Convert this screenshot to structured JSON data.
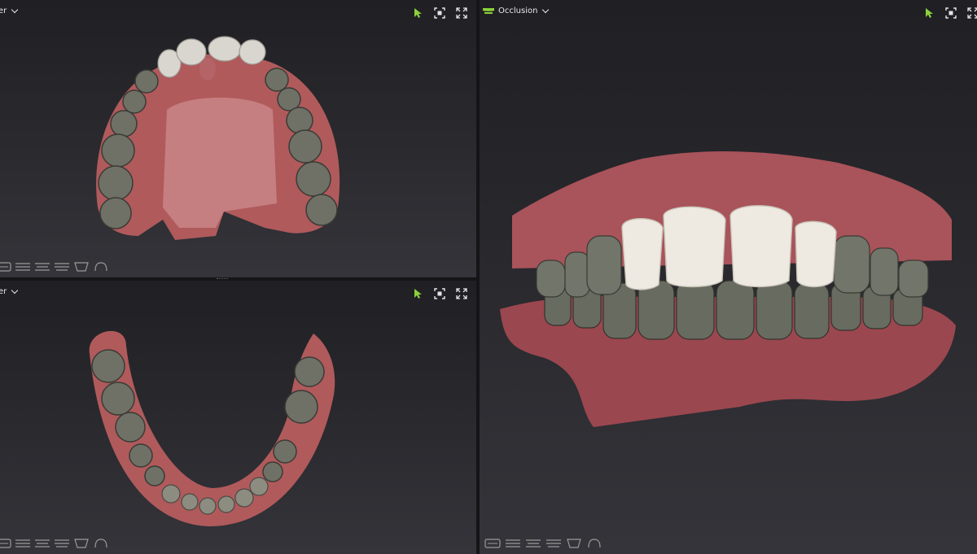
{
  "viewports": {
    "top_left": {
      "title": "er",
      "view": "upper-jaw-occlusal"
    },
    "bottom_left": {
      "title": "er",
      "view": "lower-jaw-occlusal"
    },
    "right": {
      "title": "Occlusion",
      "view": "frontal-occlusion"
    }
  },
  "toolbar": [
    "select-arrow-icon",
    "fit-view-icon",
    "fullscreen-icon"
  ],
  "view_buttons": [
    "front-view-icon",
    "upper-view-icon",
    "lower-view-icon",
    "side-view-icon",
    "jaw-front-icon",
    "jaw-outline-icon"
  ],
  "colors": {
    "accent": "#8bd23a",
    "background": "#26262b",
    "gum": "#b05a5c",
    "tooth": "#7c7d70",
    "crown": "#eeeae1"
  }
}
